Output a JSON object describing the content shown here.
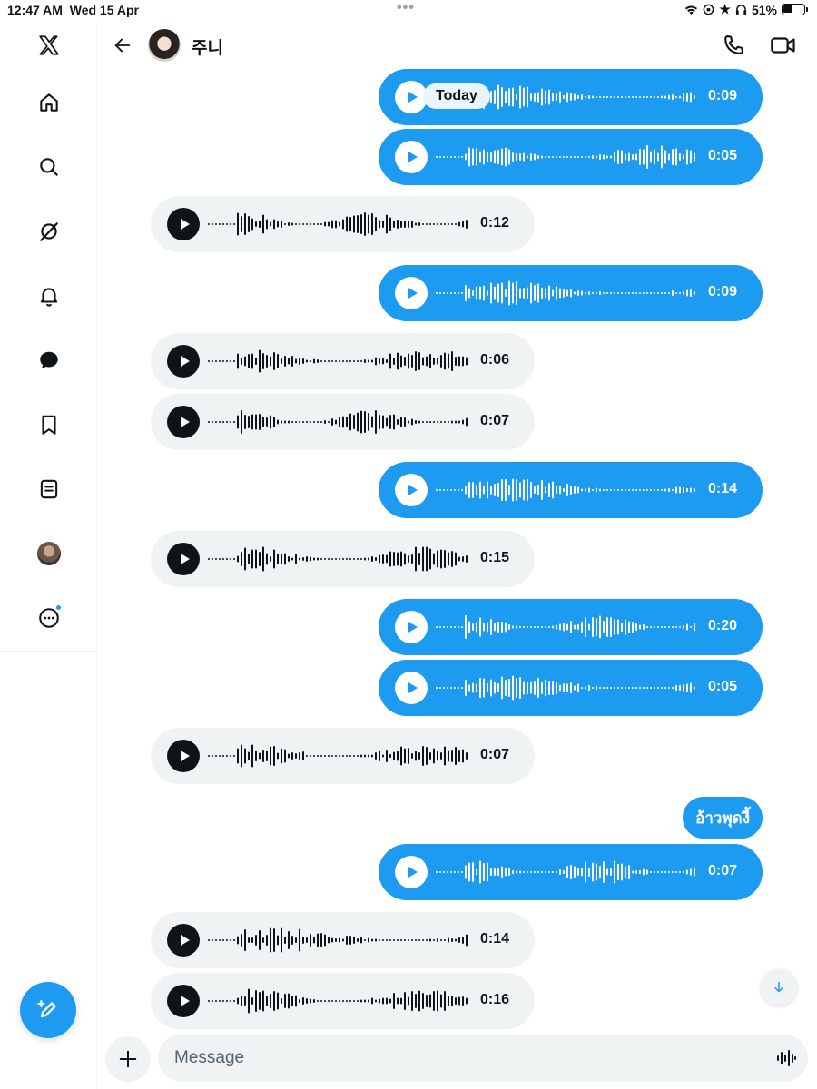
{
  "status_bar": {
    "time": "12:47 AM",
    "date": "Wed 15 Apr",
    "battery": "51%"
  },
  "sidebar": {
    "items": [
      {
        "name": "x-logo-icon"
      },
      {
        "name": "home-icon"
      },
      {
        "name": "search-icon"
      },
      {
        "name": "grok-icon"
      },
      {
        "name": "bell-icon"
      },
      {
        "name": "messages-icon"
      },
      {
        "name": "bookmark-icon"
      },
      {
        "name": "lists-icon"
      },
      {
        "name": "profile-avatar"
      },
      {
        "name": "more-icon"
      }
    ]
  },
  "header": {
    "name": "주니"
  },
  "today_label": "Today",
  "messages": [
    {
      "side": "sent",
      "duration": "0:09"
    },
    {
      "side": "sent",
      "duration": "0:05"
    },
    {
      "side": "recv",
      "duration": "0:12"
    },
    {
      "side": "sent",
      "duration": "0:09"
    },
    {
      "side": "recv",
      "duration": "0:06"
    },
    {
      "side": "recv",
      "duration": "0:07"
    },
    {
      "side": "sent",
      "duration": "0:14"
    },
    {
      "side": "recv",
      "duration": "0:15"
    },
    {
      "side": "sent",
      "duration": "0:20"
    },
    {
      "side": "sent",
      "duration": "0:05"
    },
    {
      "side": "recv",
      "duration": "0:07"
    },
    {
      "side": "sent",
      "duration": "0:07"
    },
    {
      "side": "recv",
      "duration": "0:14"
    },
    {
      "side": "recv",
      "duration": "0:16"
    }
  ],
  "text_message": "อ้าวพุดงี้",
  "composer": {
    "placeholder": "Message"
  },
  "colors": {
    "accent": "#1d9bf0",
    "received_bubble": "#eff3f4",
    "text": "#0f1419"
  }
}
